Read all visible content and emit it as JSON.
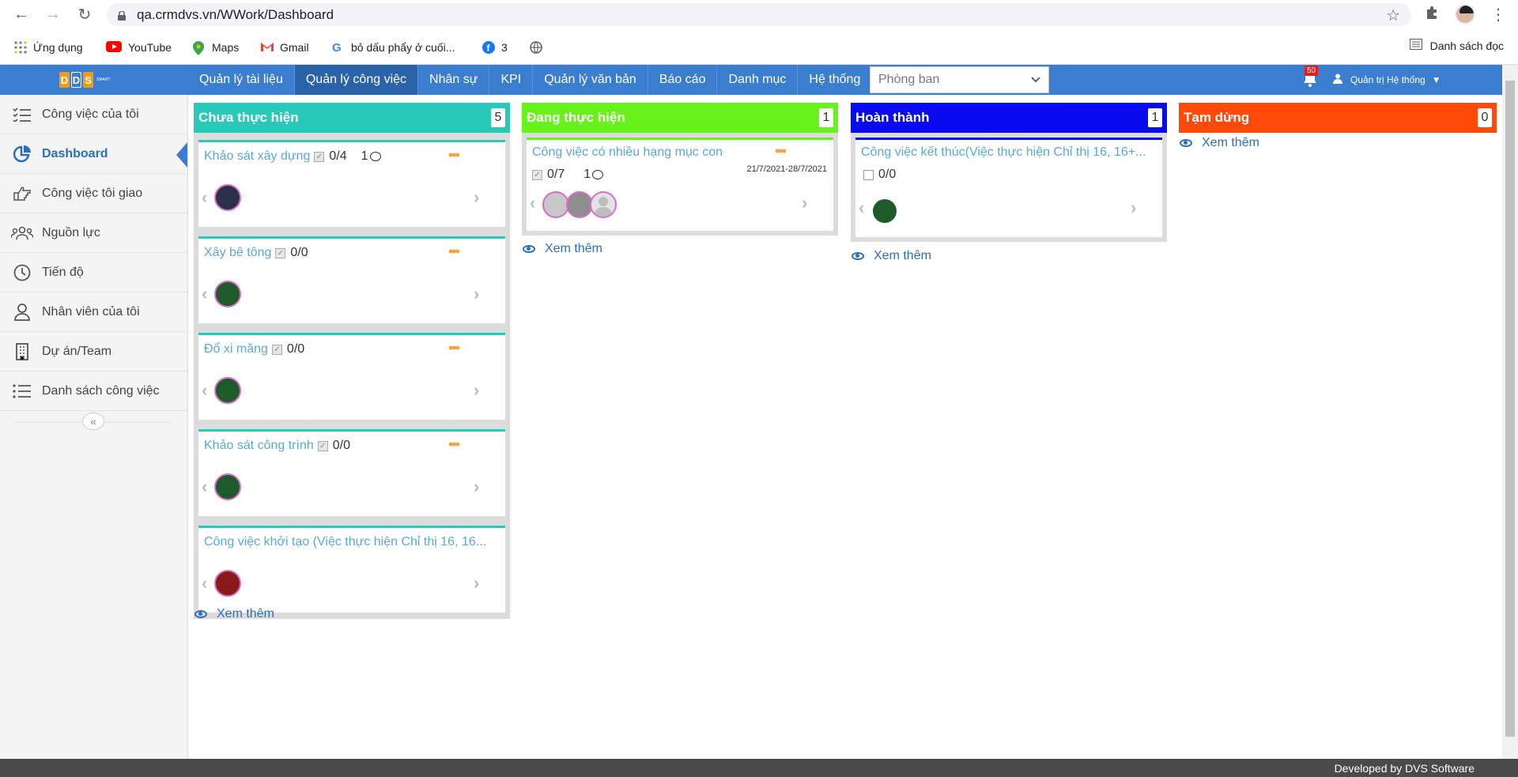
{
  "browser": {
    "url": "qa.crmdvs.vn/WWork/Dashboard",
    "bookmarks": [
      {
        "label": "Ứng dụng",
        "icon": "apps-grid-icon"
      },
      {
        "label": "YouTube",
        "icon": "youtube-icon"
      },
      {
        "label": "Maps",
        "icon": "maps-icon"
      },
      {
        "label": "Gmail",
        "icon": "gmail-icon"
      },
      {
        "label": "bỏ dấu phẩy ở cuối...",
        "icon": "google-icon"
      },
      {
        "label": "3",
        "icon": "facebook-icon"
      },
      {
        "label": "",
        "icon": "globe-icon"
      }
    ],
    "reading_list": "Danh sách đọc"
  },
  "header": {
    "logo_letters": [
      "D",
      "D",
      "S"
    ],
    "logo_small": "SMART",
    "menu": [
      "Quản lý tài liệu",
      "Quản lý công việc",
      "Nhân sự",
      "KPI",
      "Quản lý văn bản",
      "Báo cáo",
      "Danh mục",
      "Hệ thống"
    ],
    "active_menu_index": 1,
    "department_placeholder": "Phòng ban",
    "notification_count": "50",
    "user_name": "Quản trị Hệ thống"
  },
  "sidebar": {
    "items": [
      {
        "label": "Công việc của tôi",
        "icon": "task-list-icon",
        "active": false
      },
      {
        "label": "Dashboard",
        "icon": "pie-chart-icon",
        "active": true
      },
      {
        "label": "Công việc tôi giao",
        "icon": "thumb-point-icon",
        "active": false
      },
      {
        "label": "Nguồn lực",
        "icon": "users-group-icon",
        "active": false
      },
      {
        "label": "Tiến độ",
        "icon": "clock-icon",
        "active": false
      },
      {
        "label": "Nhân viên của tôi",
        "icon": "user-icon",
        "active": false
      },
      {
        "label": "Dự án/Team",
        "icon": "building-icon",
        "active": false
      },
      {
        "label": "Danh sách công việc",
        "icon": "list-icon",
        "active": false
      }
    ]
  },
  "board": {
    "see_more": "Xem thêm",
    "columns": [
      {
        "title": "Chưa thực hiện",
        "count": "5",
        "color": "#28c9b8",
        "cards": [
          {
            "title": "Khảo sát xây dựng",
            "progress": "0/4",
            "comments": "1"
          },
          {
            "title": "Xây bê tông",
            "progress": "0/0",
            "comments": ""
          },
          {
            "title": "Đổ xi măng",
            "progress": "0/0",
            "comments": ""
          },
          {
            "title": "Khảo sát công trình",
            "progress": "0/0",
            "comments": ""
          },
          {
            "title": "Công việc khởi tạo (Việc thực hiện Chỉ thị 16, 16...",
            "progress": "",
            "comments": ""
          }
        ]
      },
      {
        "title": "Đang thực hiện",
        "count": "1",
        "color": "#66f21a",
        "cards": [
          {
            "title": "Công việc có nhiều hạng mục con",
            "progress": "0/7",
            "comments": "1",
            "date": "21/7/2021-28/7/2021"
          }
        ]
      },
      {
        "title": "Hoàn thành",
        "count": "1",
        "color": "#0a0aee",
        "cards": [
          {
            "title": "Công việc kết thúc(Việc thực hiện Chỉ thị 16, 16+...",
            "progress": "0/0",
            "comments": ""
          }
        ]
      },
      {
        "title": "Tạm dừng",
        "count": "0",
        "color": "#ff4a0a",
        "cards": []
      }
    ]
  },
  "footer": "Developed by DVS Software"
}
